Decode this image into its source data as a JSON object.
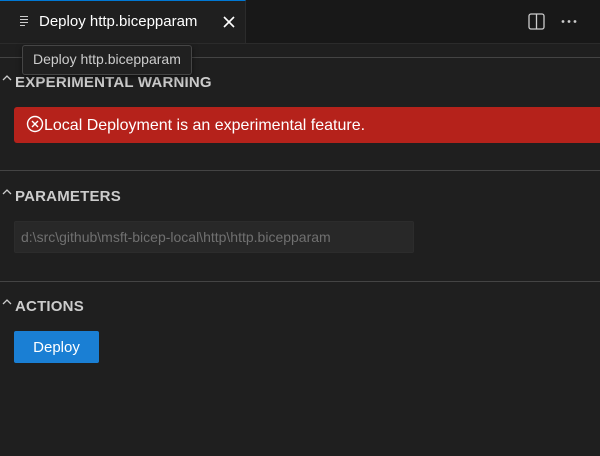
{
  "tab": {
    "title": "Deploy http.bicepparam",
    "icon": "file-lines-icon"
  },
  "tooltip": {
    "text": "Deploy http.bicepparam"
  },
  "toolbar": {
    "split_icon": "split-editor-icon",
    "more_icon": "more-actions-icon"
  },
  "sections": {
    "warning": {
      "title": "EXPERIMENTAL WARNING",
      "message": "Local Deployment is an experimental feature.",
      "icon": "error-circle-icon"
    },
    "parameters": {
      "title": "PARAMETERS",
      "file_path": "d:\\src\\github\\msft-bicep-local\\http\\http.bicepparam"
    },
    "actions": {
      "title": "ACTIONS",
      "deploy_label": "Deploy"
    }
  },
  "colors": {
    "background": "#1f1f1f",
    "tab_active_border": "#0078d4",
    "warning_background": "#b5221b",
    "button_background": "#1a7fd4"
  }
}
